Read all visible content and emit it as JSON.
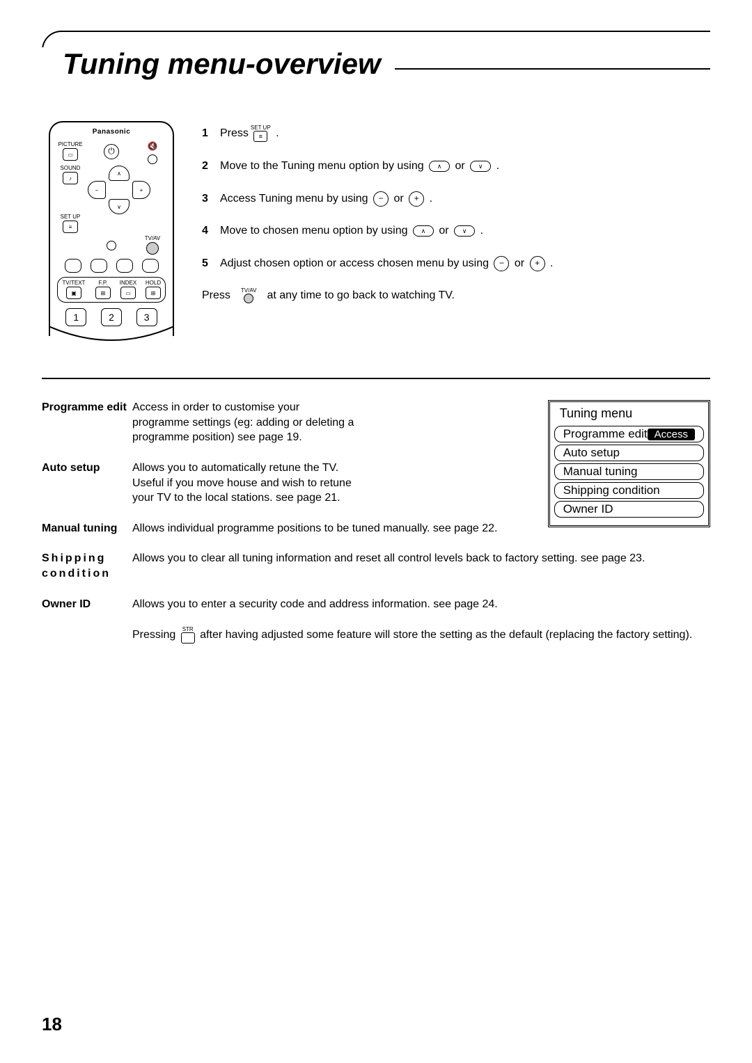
{
  "page_title": "Tuning menu-overview",
  "page_number": "18",
  "remote": {
    "brand": "Panasonic",
    "labels": {
      "picture": "PICTURE",
      "sound": "SOUND",
      "setup": "SET UP",
      "tvav": "TV/AV",
      "tvtext": "TV/TEXT",
      "fp": "F.P.",
      "index": "INDEX",
      "hold": "HOLD"
    },
    "dpad": {
      "up": "∧",
      "down": "∨",
      "left": "−",
      "right": "+"
    },
    "numbers": [
      "1",
      "2",
      "3"
    ]
  },
  "steps": [
    {
      "num": "1",
      "before": "Press",
      "icon": "setup",
      "after": " ."
    },
    {
      "num": "2",
      "before": "Move to the Tuning menu option by using ",
      "icon": "nav-ud",
      "after": " ."
    },
    {
      "num": "3",
      "before": "Access Tuning menu by using ",
      "icon": "nav-lr",
      "after": " ."
    },
    {
      "num": "4",
      "before": "Move to chosen menu option by using ",
      "icon": "nav-ud",
      "after": " ."
    },
    {
      "num": "5",
      "before": "Adjust chosen option or access chosen menu by using ",
      "icon": "nav-lr",
      "after": " ."
    }
  ],
  "step_footer": {
    "before": "Press ",
    "icon_label": "TV/AV",
    "after": " at any time to go back to watching TV."
  },
  "definitions": [
    {
      "term": "Programme edit",
      "desc": "Access in order to customise your programme settings (eg: adding or deleting a programme position) see page 19."
    },
    {
      "term": "Auto setup",
      "desc": "Allows you to automatically retune the TV. Useful if you move house and wish to retune your TV to the local stations. see page 21."
    },
    {
      "term": "Manual tuning",
      "term_display": "Manual tun­ing",
      "desc": "Allows individual programme positions to be tuned manually. see page 22."
    },
    {
      "term": "Shipping condition",
      "spaced": true,
      "desc": "Allows you to clear all tuning information and reset all control levels back to factory setting. see page 23."
    },
    {
      "term": "Owner ID",
      "desc": "Allows you to enter a security code and address information. see page 24."
    }
  ],
  "footnote": {
    "before": "Pressing ",
    "icon_label": "STR",
    "after": " after having adjusted some feature will store the setting as the  default (replacing the factory setting)."
  },
  "osd": {
    "title": "Tuning menu",
    "items": [
      {
        "label": "Programme edit",
        "badge": "Access"
      },
      {
        "label": "Auto setup"
      },
      {
        "label": "Manual tuning"
      },
      {
        "label": "Shipping condition"
      },
      {
        "label": "Owner ID"
      }
    ]
  }
}
